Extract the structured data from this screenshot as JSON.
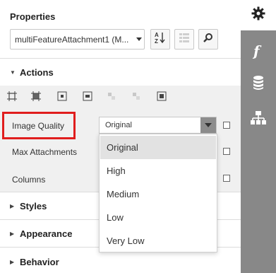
{
  "panel": {
    "title": "Properties",
    "component_select": {
      "value": "multiFeatureAttachment1 (M..."
    },
    "toolbar": {
      "sort_alpha_icon": "sort-alpha-icon",
      "categorize_icon": "categorize-icon",
      "search_icon": "search-icon"
    }
  },
  "sections": {
    "actions": {
      "label": "Actions",
      "expanded": true
    },
    "styles": {
      "label": "Styles",
      "expanded": false
    },
    "appearance": {
      "label": "Appearance",
      "expanded": false
    },
    "behavior": {
      "label": "Behavior",
      "expanded": false
    }
  },
  "action_icons": [
    "fit-width-icon",
    "fit-bounds-icon",
    "center-horizontally-icon",
    "center-vertically-icon",
    "align-disabled-icon",
    "align-disabled-icon-2",
    "center-in-container-icon"
  ],
  "properties": {
    "image_quality": {
      "label": "Image Quality",
      "value": "Original"
    },
    "max_attachments": {
      "label": "Max Attachments"
    },
    "columns": {
      "label": "Columns"
    }
  },
  "dropdown": {
    "options": [
      "Original",
      "High",
      "Medium",
      "Low",
      "Very Low"
    ],
    "selected_index": 0
  },
  "rail": {
    "icons": [
      "gear-icon",
      "function-icon",
      "database-icon",
      "hierarchy-icon"
    ]
  },
  "colors": {
    "highlight_border": "#e01d1d",
    "rail_band": "#888888",
    "actions_background": "#f0f0f0",
    "selected_option": "#e2e2e2"
  }
}
